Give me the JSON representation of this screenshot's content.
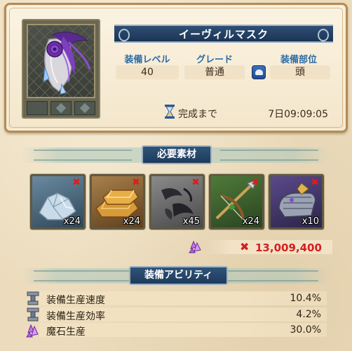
{
  "item": {
    "name": "イーヴィルマスク",
    "icon": "evil-mask-icon"
  },
  "stats": {
    "level_label": "装備レベル",
    "level_value": "40",
    "grade_label": "グレード",
    "grade_value": "普通",
    "part_label": "装備部位",
    "part_value": "頭",
    "part_icon": "helmet-icon"
  },
  "timer": {
    "label": "完成まで",
    "value": "7日09:09:05"
  },
  "materials": {
    "section_title": "必要素材",
    "items": [
      {
        "icon": "crystal-ore-icon",
        "count": "x24",
        "missing": true
      },
      {
        "icon": "gold-ingot-icon",
        "count": "x24",
        "missing": true
      },
      {
        "icon": "dark-feather-icon",
        "count": "x45",
        "missing": true
      },
      {
        "icon": "crossbow-icon",
        "count": "x24",
        "missing": true
      },
      {
        "icon": "gauntlet-icon",
        "count": "x10",
        "missing": true
      }
    ],
    "missing_mark": "✖",
    "cost_icon": "magic-stone-icon",
    "cost_value": "13,009,400"
  },
  "abilities": {
    "section_title": "装備アビリティ",
    "items": [
      {
        "icon": "anvil-icon",
        "label": "装備生産速度",
        "value": "10.4%"
      },
      {
        "icon": "anvil-icon",
        "label": "装備生産効率",
        "value": "4.2%"
      },
      {
        "icon": "magic-stone-icon",
        "label": "魔石生産",
        "value": "30.0%"
      }
    ]
  }
}
